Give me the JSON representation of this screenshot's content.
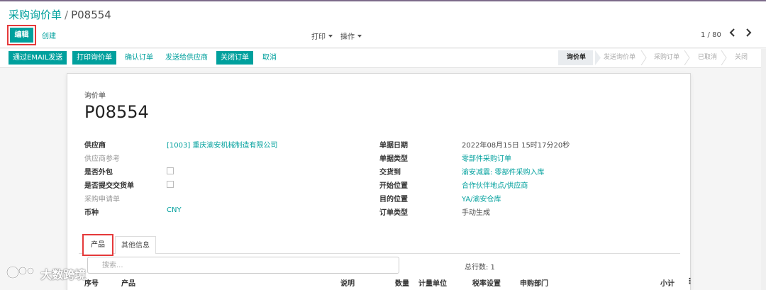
{
  "breadcrumb": {
    "parent": "采购询价单",
    "separator": "/",
    "current": "P08554"
  },
  "control": {
    "edit_label": "编辑",
    "create_label": "创建",
    "print_label": "打印",
    "action_label": "操作",
    "pager_text": "1 / 80"
  },
  "actions": {
    "email": "通过EMAIL发送",
    "print_rfq": "打印询价单",
    "confirm_order": "确认订单",
    "send_supplier": "发送给供应商",
    "close_order": "关闭订单",
    "cancel": "取消"
  },
  "status_stages": [
    "询价单",
    "发送询价单",
    "采购订单",
    "已取消",
    "关闭"
  ],
  "status_active": 0,
  "form": {
    "doc_label": "询价单",
    "doc_name": "P08554",
    "left": [
      {
        "label": "供应商",
        "value": "[1003] 重庆渝安机械制造有限公司",
        "type": "link",
        "muted": false
      },
      {
        "label": "供应商参考",
        "value": "",
        "type": "text",
        "muted": true
      },
      {
        "label": "是否外包",
        "value": "",
        "type": "checkbox",
        "muted": false
      },
      {
        "label": "是否提交交货单",
        "value": "",
        "type": "checkbox",
        "muted": false
      },
      {
        "label": "采购申请单",
        "value": "",
        "type": "text",
        "muted": true
      },
      {
        "label": "币种",
        "value": "CNY",
        "type": "link",
        "muted": false
      }
    ],
    "right": [
      {
        "label": "单据日期",
        "value": "2022年08月15日 15时17分20秒",
        "type": "text"
      },
      {
        "label": "单据类型",
        "value": "零部件采购订单",
        "type": "link"
      },
      {
        "label": "交货到",
        "value": "渝安减震: 零部件采购入库",
        "type": "link"
      },
      {
        "label": "开始位置",
        "value": "合作伙伴地点/供应商",
        "type": "link"
      },
      {
        "label": "目的位置",
        "value": "YA/渝安仓库",
        "type": "link"
      },
      {
        "label": "订单类型",
        "value": "手动生成",
        "type": "text"
      }
    ]
  },
  "tabs": {
    "product": "产品",
    "other": "其他信息"
  },
  "lines": {
    "search_placeholder": "搜索...",
    "total_rows": "总行数: 1",
    "columns": [
      "序号",
      "产品",
      "说明",
      "数量",
      "计量单位",
      "税率设置",
      "申购部门",
      "小计"
    ],
    "kebab": "⋮"
  },
  "watermark": {
    "text": "大数跨境"
  },
  "colors": {
    "primary": "#00a09d",
    "highlight": "#e5393a",
    "header_line": "#7c6a8a"
  },
  "icons": {
    "prev": "chevron-left-icon",
    "next": "chevron-right-icon",
    "caret": "caret-down-icon"
  }
}
